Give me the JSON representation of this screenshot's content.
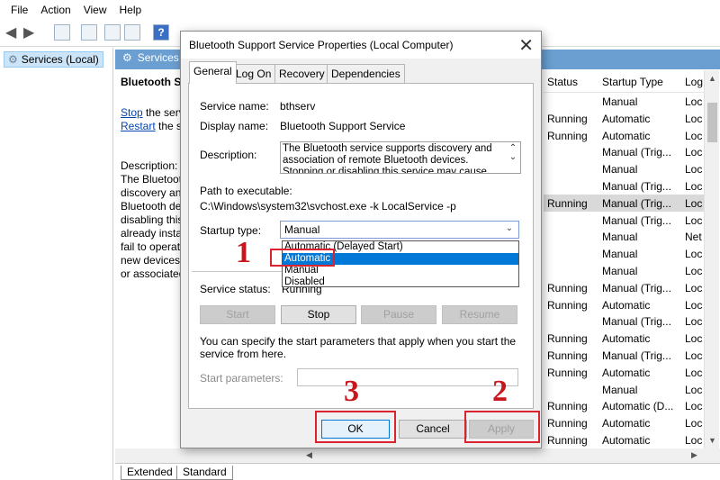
{
  "menu": [
    "File",
    "Action",
    "View",
    "Help"
  ],
  "tree": {
    "label": "Services (Local)"
  },
  "main": {
    "header": "Services (Local)",
    "selected_title": "Bluetooth Support Service",
    "stop_link": "Stop",
    "stop_rest": " the service",
    "restart_link": "Restart",
    "restart_rest": " the service",
    "description_label": "Description:",
    "description_lines": [
      "The Bluetooth service supports",
      "discovery and association of",
      "Bluetooth devices. Stopping or",
      "disabling this service may cause",
      "already installed Bluetooth",
      "fail to operate properly and",
      "new devices to be prevented",
      "or associated."
    ]
  },
  "columns": {
    "status": "Status",
    "startup": "Startup Type",
    "logon": "Log"
  },
  "rows": [
    {
      "status": "",
      "startup": "Manual",
      "logon": "Loc"
    },
    {
      "status": "Running",
      "startup": "Automatic",
      "logon": "Loc"
    },
    {
      "status": "Running",
      "startup": "Automatic",
      "logon": "Loc"
    },
    {
      "status": "",
      "startup": "Manual (Trig...",
      "logon": "Loc"
    },
    {
      "status": "",
      "startup": "Manual",
      "logon": "Loc"
    },
    {
      "status": "",
      "startup": "Manual (Trig...",
      "logon": "Loc"
    },
    {
      "status": "Running",
      "startup": "Manual (Trig...",
      "logon": "Loc"
    },
    {
      "status": "",
      "startup": "Manual (Trig...",
      "logon": "Loc"
    },
    {
      "status": "",
      "startup": "Manual",
      "logon": "Net"
    },
    {
      "status": "",
      "startup": "Manual",
      "logon": "Loc"
    },
    {
      "status": "",
      "startup": "Manual",
      "logon": "Loc"
    },
    {
      "status": "Running",
      "startup": "Manual (Trig...",
      "logon": "Loc"
    },
    {
      "status": "Running",
      "startup": "Automatic",
      "logon": "Loc"
    },
    {
      "status": "",
      "startup": "Manual (Trig...",
      "logon": "Loc"
    },
    {
      "status": "Running",
      "startup": "Automatic",
      "logon": "Loc"
    },
    {
      "status": "Running",
      "startup": "Manual (Trig...",
      "logon": "Loc"
    },
    {
      "status": "Running",
      "startup": "Automatic",
      "logon": "Loc"
    },
    {
      "status": "",
      "startup": "Manual",
      "logon": "Loc"
    },
    {
      "status": "Running",
      "startup": "Automatic (D...",
      "logon": "Loc"
    },
    {
      "status": "Running",
      "startup": "Automatic",
      "logon": "Loc"
    },
    {
      "status": "Running",
      "startup": "Automatic",
      "logon": "Loc"
    }
  ],
  "bottom_tabs": [
    "Extended",
    "Standard"
  ],
  "dialog": {
    "title": "Bluetooth Support Service Properties (Local Computer)",
    "tabs": [
      "General",
      "Log On",
      "Recovery",
      "Dependencies"
    ],
    "service_name_label": "Service name:",
    "service_name": "bthserv",
    "display_name_label": "Display name:",
    "display_name": "Bluetooth Support Service",
    "description_label": "Description:",
    "description": "The Bluetooth service supports discovery and association of remote Bluetooth devices.  Stopping or disabling this service may cause already installed",
    "path_label": "Path to executable:",
    "path": "C:\\Windows\\system32\\svchost.exe -k LocalService -p",
    "startup_label": "Startup type:",
    "startup_value": "Manual",
    "startup_options": [
      "Automatic (Delayed Start)",
      "Automatic",
      "Manual",
      "Disabled"
    ],
    "status_label": "Service status:",
    "status_value": "Running",
    "btn_start": "Start",
    "btn_stop": "Stop",
    "btn_pause": "Pause",
    "btn_resume": "Resume",
    "params_note": "You can specify the start parameters that apply when you start the service from here.",
    "params_label": "Start parameters:",
    "ok": "OK",
    "cancel": "Cancel",
    "apply": "Apply"
  },
  "annotations": [
    "1",
    "2",
    "3"
  ],
  "accent": "#0078d7",
  "annotation_color": "#d9232e"
}
